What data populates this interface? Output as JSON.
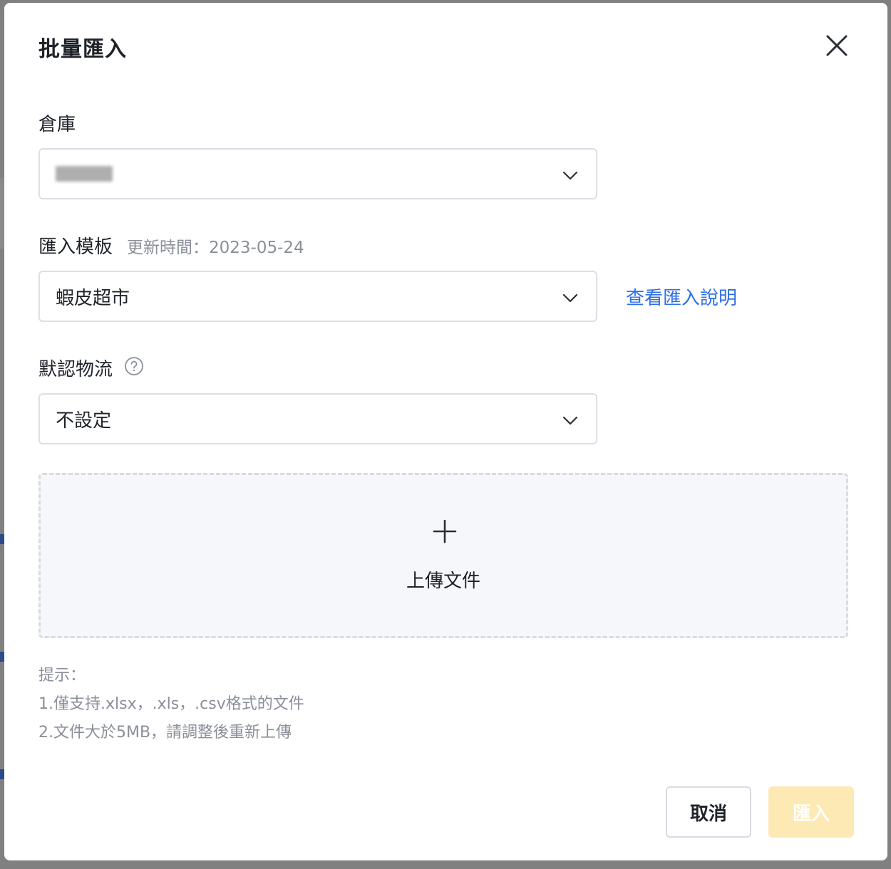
{
  "dialog": {
    "title": "批量匯入",
    "close_icon": "close-icon"
  },
  "warehouse": {
    "label": "倉庫",
    "value_redacted": true
  },
  "template": {
    "label": "匯入模板",
    "update_time": "更新時間：2023-05-24",
    "value": "蝦皮超市",
    "help_link": "查看匯入說明"
  },
  "logistics": {
    "label": "默認物流",
    "help_icon": "question-circle-icon",
    "value": "不設定"
  },
  "upload": {
    "icon": "plus-icon",
    "label": "上傳文件"
  },
  "hints": {
    "title": "提示：",
    "line1": "1.僅支持.xlsx，.xls，.csv格式的文件",
    "line2": "2.文件大於5MB，請調整後重新上傳"
  },
  "footer": {
    "cancel_label": "取消",
    "import_label": "匯入",
    "import_disabled": true
  },
  "colors": {
    "link": "#2f6fe4",
    "primary_disabled": "#fde9b4",
    "muted_text": "#8a8f99"
  }
}
